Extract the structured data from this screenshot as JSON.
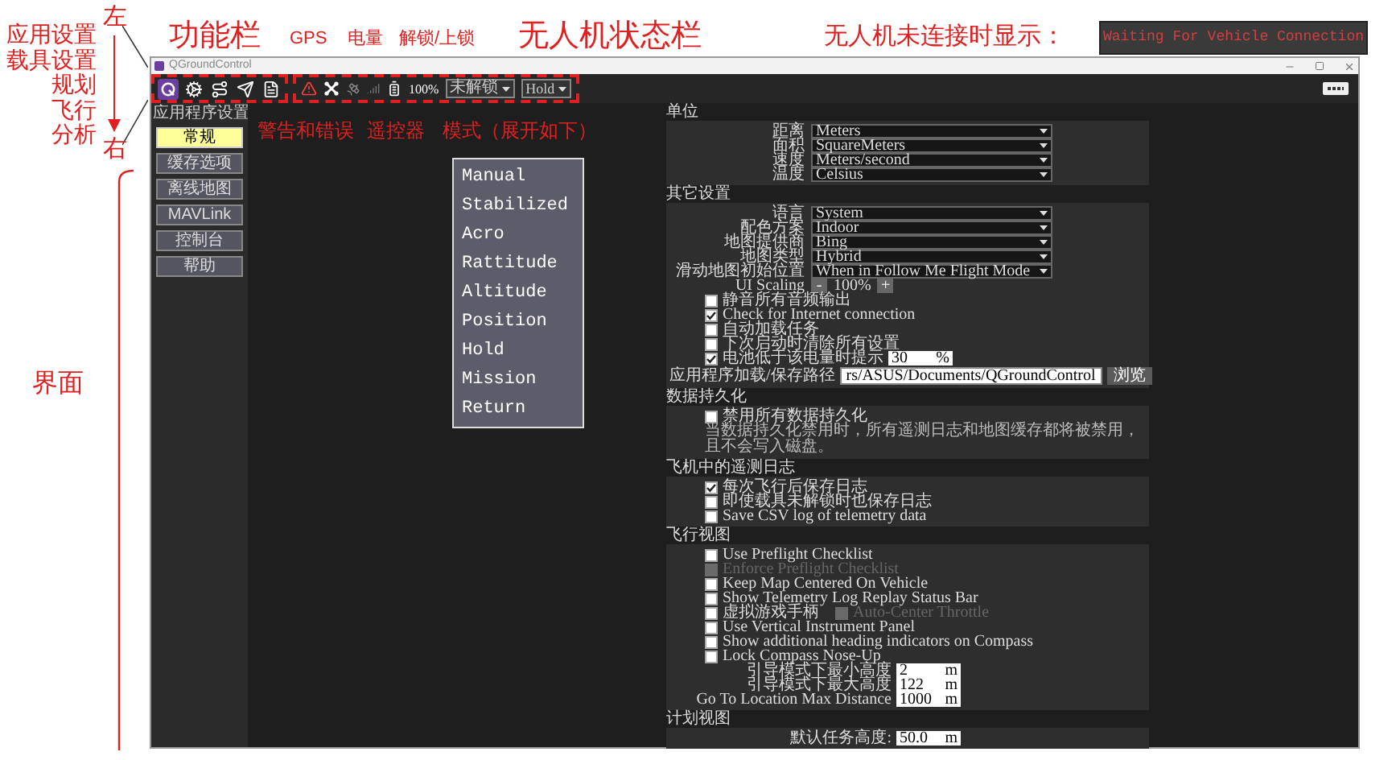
{
  "annotations": {
    "left_top": "左",
    "left_bottom": "右",
    "view_labels": [
      "应用设置",
      "载具设置",
      "规划",
      "飞行",
      "分析"
    ],
    "interface": "界面",
    "function_bar": "功能栏",
    "gps": "GPS",
    "battery": "电量",
    "arming": "解锁/上锁",
    "status_bar": "无人机状态栏",
    "warnings": "警告和错误",
    "remote": "遥控器",
    "mode": "模式（展开如下）",
    "disconnected_label": "无人机未连接时显示：",
    "disconnected_message": "Waiting For Vehicle Connection"
  },
  "window": {
    "title": "QGroundControl"
  },
  "toolbar": {
    "tools": [
      {
        "kind": "settings",
        "selected": true
      },
      {
        "kind": "vehicle",
        "selected": false
      },
      {
        "kind": "plan",
        "selected": false
      },
      {
        "kind": "fly",
        "selected": false
      },
      {
        "kind": "analyze",
        "selected": false
      }
    ],
    "battery": "100%",
    "arming": "未解锁",
    "mode": "Hold"
  },
  "sidebar": {
    "title": "应用程序设置",
    "items": [
      {
        "label": "常规",
        "selected": true
      },
      {
        "label": "缓存选项",
        "selected": false
      },
      {
        "label": "离线地图",
        "selected": false
      },
      {
        "label": "MAVLink",
        "selected": false
      },
      {
        "label": "控制台",
        "selected": false
      },
      {
        "label": "帮助",
        "selected": false
      }
    ]
  },
  "mode_menu": [
    "Manual",
    "Stabilized",
    "Acro",
    "Rattitude",
    "Altitude",
    "Position",
    "Hold",
    "Mission",
    "Return"
  ],
  "sections": [
    {
      "title": "单位",
      "rows": [
        {
          "kind": "select",
          "label": "距离",
          "value": "Meters"
        },
        {
          "kind": "select",
          "label": "面积",
          "value": "SquareMeters"
        },
        {
          "kind": "select",
          "label": "速度",
          "value": "Meters/second"
        },
        {
          "kind": "select",
          "label": "温度",
          "value": "Celsius"
        }
      ]
    },
    {
      "title": "其它设置",
      "rows": [
        {
          "kind": "select",
          "label": "语言",
          "value": "System"
        },
        {
          "kind": "select",
          "label": "配色方案",
          "value": "Indoor"
        },
        {
          "kind": "select",
          "label": "地图提供商",
          "value": "Bing"
        },
        {
          "kind": "select",
          "label": "地图类型",
          "value": "Hybrid"
        },
        {
          "kind": "select",
          "label": "滑动地图初始位置",
          "value": "When in Follow Me Flight Mode"
        },
        {
          "kind": "scaling",
          "label": "UI Scaling",
          "minus": "-",
          "value": "100%",
          "plus": "+"
        },
        {
          "kind": "check",
          "label": "静音所有音频输出",
          "checked": false,
          "disabled": false
        },
        {
          "kind": "check",
          "label": "Check for Internet connection",
          "checked": true,
          "disabled": false
        },
        {
          "kind": "check",
          "label": "自动加载任务",
          "checked": false,
          "disabled": false
        },
        {
          "kind": "check",
          "label": "下次启动时清除所有设置",
          "checked": false,
          "disabled": false
        },
        {
          "kind": "check_field",
          "label": "电池低于该电量时提示",
          "checked": true,
          "disabled": false,
          "value": "30",
          "unit": "%"
        },
        {
          "kind": "path",
          "label": "应用程序加载/保存路径",
          "value": "rs/ASUS/Documents/QGroundControl",
          "button": "浏览"
        }
      ]
    },
    {
      "title": "数据持久化",
      "rows": [
        {
          "kind": "check",
          "label": "禁用所有数据持久化",
          "checked": false,
          "disabled": false
        },
        {
          "kind": "note",
          "text": "当数据持久化禁用时，所有遥测日志和地图缓存都将被禁用，且不会写入磁盘。"
        }
      ]
    },
    {
      "title": "飞机中的遥测日志",
      "rows": [
        {
          "kind": "check",
          "label": "每次飞行后保存日志",
          "checked": true,
          "disabled": false
        },
        {
          "kind": "check",
          "label": "即使载具未解锁时也保存日志",
          "checked": false,
          "disabled": false
        },
        {
          "kind": "check",
          "label": "Save CSV log of telemetry data",
          "checked": false,
          "disabled": false
        }
      ]
    },
    {
      "title": "飞行视图",
      "rows": [
        {
          "kind": "check",
          "label": "Use Preflight Checklist",
          "checked": false,
          "disabled": false
        },
        {
          "kind": "check",
          "label": "Enforce Preflight Checklist",
          "checked": false,
          "disabled": true
        },
        {
          "kind": "check",
          "label": "Keep Map Centered On Vehicle",
          "checked": false,
          "disabled": false
        },
        {
          "kind": "check",
          "label": "Show Telemetry Log Replay Status Bar",
          "checked": false,
          "disabled": false
        },
        {
          "kind": "check_pair",
          "label": "虚拟游戏手柄",
          "checked": false,
          "disabled": false,
          "second": {
            "label": "Auto-Center Throttle",
            "checked": false,
            "disabled": true
          }
        },
        {
          "kind": "check",
          "label": "Use Vertical Instrument Panel",
          "checked": false,
          "disabled": false
        },
        {
          "kind": "check",
          "label": "Show additional heading indicators on Compass",
          "checked": false,
          "disabled": false
        },
        {
          "kind": "check",
          "label": "Lock Compass Nose-Up",
          "checked": false,
          "disabled": false
        },
        {
          "kind": "field",
          "label": "引导模式下最小高度",
          "value": "2",
          "unit": "m"
        },
        {
          "kind": "field",
          "label": "引导模式下最大高度",
          "value": "122",
          "unit": "m"
        },
        {
          "kind": "field",
          "label": "Go To Location Max Distance",
          "value": "1000",
          "unit": "m"
        }
      ]
    },
    {
      "title": "计划视图",
      "rows": [
        {
          "kind": "field",
          "label": "默认任务高度:",
          "value": "50.0",
          "unit": "m"
        }
      ]
    }
  ]
}
